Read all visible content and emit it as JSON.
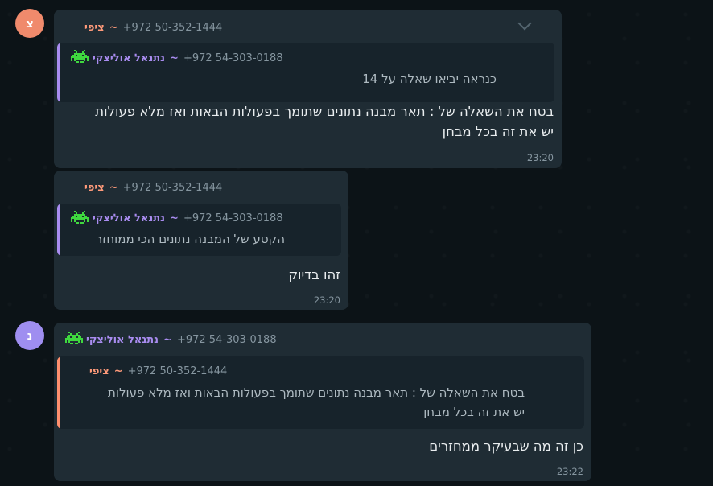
{
  "colors": {
    "bg": "#0c1317",
    "bubble": "#1f2c34",
    "quote_bg": "#17232b",
    "tzipi": "#ff9a7a",
    "netanel": "#a98cf0",
    "timestamp": "#8696a0"
  },
  "messages": [
    {
      "avatar": "צ",
      "sender_name": "ציפי",
      "sender_phone": "+972 50-352-1444",
      "quote": {
        "name": "נתנאל אוליצקי",
        "phone": "+972 54-303-0188",
        "text": "כנראה יביאו שאלה על 14"
      },
      "text_line1": "בטח את השאלה של : תאר מבנה נתונים שתומך בפעולות הבאות ואז מלא פעולות",
      "text_line2": "יש את זה בכל מבחן",
      "time": "23:20"
    },
    {
      "sender_name": "ציפי",
      "sender_phone": "+972 50-352-1444",
      "quote": {
        "name": "נתנאל אוליצקי",
        "phone": "+972 54-303-0188",
        "text": "הקטע של המבנה נתונים הכי ממוחזר"
      },
      "text": "זהו בדיוק",
      "time": "23:20"
    },
    {
      "avatar": "נ",
      "sender_name": "נתנאל אוליצקי",
      "sender_phone": "+972 54-303-0188",
      "quote": {
        "name": "ציפי",
        "phone": "+972 50-352-1444",
        "text_line1": "בטח את השאלה של : תאר מבנה נתונים שתומך בפעולות הבאות ואז מלא פעולות",
        "text_line2": "יש את זה בכל מבחן"
      },
      "text": "כן זה מה שבעיקר ממחזרים",
      "time": "23:22"
    }
  ]
}
